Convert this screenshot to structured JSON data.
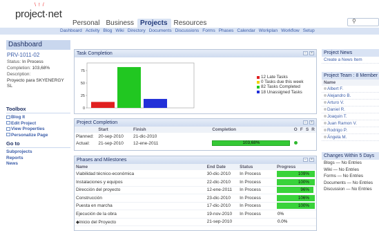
{
  "header": {
    "logo_text": "project·net",
    "logo_rays": "\\ ! /",
    "tabs": [
      {
        "label": "Personal",
        "active": false
      },
      {
        "label": "Business",
        "active": false
      },
      {
        "label": "Projects",
        "active": true
      },
      {
        "label": "Resources",
        "active": false
      }
    ],
    "search_icon": "magnifier-icon"
  },
  "subnav": [
    "Dashboard",
    "Activity",
    "Blog",
    "Wiki",
    "Directory",
    "Documents",
    "Discussions",
    "Forms",
    "Phases",
    "Calendar",
    "Workplan",
    "Workflow",
    "Setup"
  ],
  "sidebar": {
    "title": "Dashboard",
    "project_id": "PRV-1011-02",
    "status_label": "Status:",
    "status_value": "In Process",
    "completion_label": "Completion:",
    "completion_value": "103,68%",
    "description_label": "Description:",
    "description_value": "Proyecto para SKYENERGY SL",
    "toolbox_title": "Toolbox",
    "toolbox": [
      "Blog It",
      "Edit Project",
      "View Properties",
      "Personalize Page"
    ],
    "goto_title": "Go to",
    "goto": [
      "Subprojects",
      "Reports",
      "News"
    ]
  },
  "task_panel": {
    "title": "Task Completion",
    "chart_data": {
      "type": "bar",
      "categories": [
        "Late Tasks",
        "Tasks due this week",
        "Tasks Completed",
        "Unassigned Tasks"
      ],
      "values": [
        12,
        0,
        82,
        18
      ],
      "ylim": [
        0,
        75
      ],
      "yticks": [
        0,
        25,
        50,
        75
      ],
      "colors": [
        "#e02020",
        "#f0d000",
        "#21c721",
        "#2230d8"
      ],
      "legend": [
        "12 Late Tasks",
        "0 Tasks due this week",
        "82 Tasks Completed",
        "18 Unassigned Tasks"
      ]
    }
  },
  "completion_panel": {
    "title": "Project Completion",
    "headers": [
      "",
      "Start",
      "Finish",
      "Completion",
      "O",
      "F",
      "S",
      "R"
    ],
    "rows": [
      {
        "label": "Planned:",
        "start": "20-sep-2010",
        "finish": "21-dic-2010",
        "completion": "",
        "pct": null
      },
      {
        "label": "Actual:",
        "start": "21-sep-2010",
        "finish": "12-ene-2011",
        "completion": "103,68%",
        "pct": 1.0
      }
    ]
  },
  "phases_panel": {
    "title": "Phases and Milestones",
    "headers": [
      "Name",
      "End Date",
      "Status",
      "Progress"
    ],
    "rows": [
      {
        "name": "Viabilidad técnico-económica",
        "end": "30-dic-2010",
        "status": "In Process",
        "progress": "109%",
        "pct": 1.0
      },
      {
        "name": "Instalaciones y equipos",
        "end": "22-dic-2010",
        "status": "In Process",
        "progress": "100%",
        "pct": 1.0
      },
      {
        "name": "Dirección del proyecto",
        "end": "12-ene-2011",
        "status": "In Process",
        "progress": "96%",
        "pct": 0.96
      },
      {
        "name": "Construcción",
        "end": "23-dic-2010",
        "status": "In Process",
        "progress": "106%",
        "pct": 1.0
      },
      {
        "name": "Puesta en marcha",
        "end": "17-dic-2010",
        "status": "In Process",
        "progress": "100%",
        "pct": 1.0
      },
      {
        "name": "Ejecución de la obra",
        "end": "19-nov-2010",
        "status": "In Process",
        "progress": "0%",
        "pct": 0
      },
      {
        "name": "◆Inicio del Proyecto",
        "end": "21-sep-2010",
        "status": "",
        "progress": "0.0%",
        "pct": 0
      }
    ]
  },
  "right": {
    "news_title": "Project News",
    "news_link": "Create a News Item",
    "team_title": "Project Team : 8 Member",
    "team_col": "Name",
    "team": [
      "Albert F.",
      "Alejandro B.",
      "Arturo V.",
      "Daniel R.",
      "Joaquin T.",
      "Juan Ramon V.",
      "Rodrigo P.",
      "Ángela M."
    ],
    "changes_title": "Changes Within 5 Days",
    "changes": [
      "Blogs — No Entries",
      "Wiki — No Entries",
      "Forms — No Entries",
      "Documents — No Entries",
      "Discussion — No Entries"
    ]
  }
}
